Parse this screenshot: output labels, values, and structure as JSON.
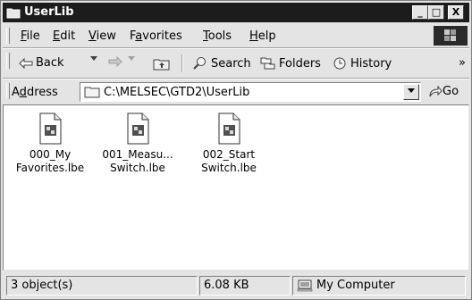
{
  "window": {
    "title": "UserLib"
  },
  "title_buttons": {
    "minimize": "_",
    "maximize": "□",
    "close": "X"
  },
  "menu": {
    "file": {
      "hot": "F",
      "rest": "ile"
    },
    "edit": {
      "hot": "E",
      "rest": "dit"
    },
    "view": {
      "hot": "V",
      "rest": "iew"
    },
    "favorites": {
      "pre": "F",
      "hot": "a",
      "rest": "vorites"
    },
    "tools": {
      "hot": "T",
      "rest": "ools"
    },
    "help": {
      "hot": "H",
      "rest": "elp"
    }
  },
  "toolbar": {
    "back": "Back",
    "search": "Search",
    "folders": "Folders",
    "history": "History",
    "overflow": "»"
  },
  "address": {
    "label_pre": "A",
    "label_hot": "d",
    "label_rest": "dress",
    "path": "C:\\MELSEC\\GTD2\\UserLib",
    "go": "Go"
  },
  "files": [
    {
      "line1": "000_My",
      "line2": "Favorites.lbe",
      "icon": "lbe-file-icon"
    },
    {
      "line1": "001_Measu...",
      "line2": "Switch.lbe",
      "icon": "lbe-file-icon"
    },
    {
      "line1": "002_Start",
      "line2": "Switch.lbe",
      "icon": "lbe-file-icon"
    }
  ],
  "status": {
    "objects": "3 object(s)",
    "size": "6.08 KB",
    "zone": "My Computer"
  }
}
